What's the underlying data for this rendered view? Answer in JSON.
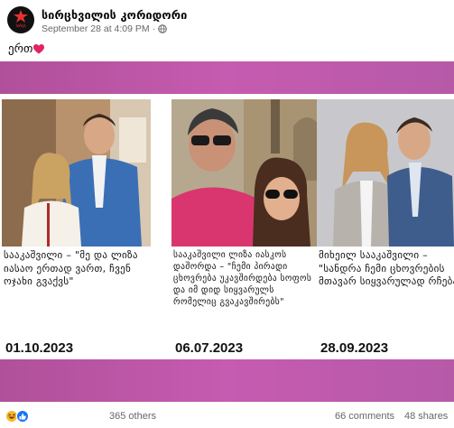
{
  "post": {
    "page_name": "სირცხვილის კორიდორი",
    "avatar_text": "სირცხვილის კორიდორი",
    "timestamp": "September 28 at 4:09 PM",
    "separator": "·",
    "privacy_icon": "globe-icon",
    "caption_text": "ერთ",
    "caption_emoji": "red-heart-icon"
  },
  "image": {
    "band_color": "#c05aaa",
    "panels": [
      {
        "quote": "სააკაშვილი – \"მე და ლიზა იასაო ერთად ვართ, ჩვენ ოჯახი გვაქვს\"",
        "date": "01.10.2023"
      },
      {
        "quote": "სააკაშვილი ლიზა იასკოს დაშორდა – \"ჩემი პირადი ცხოვრება უკავშირდება სოფოს და იმ დიდ სიყვარულს რომელიც გვაკავშირებს\"",
        "date": "06.07.2023"
      },
      {
        "quote": "მიხეილ სააკაშვილი – \"სანდრა ჩემი ცხოვრების მთავარ სიყვარულად რჩება\"",
        "date": "28.09.2023"
      }
    ]
  },
  "footer": {
    "reaction_icons": [
      "haha-reaction-icon",
      "like-reaction-icon"
    ],
    "others": "365 others",
    "comments": "66 comments",
    "shares": "48 shares"
  }
}
